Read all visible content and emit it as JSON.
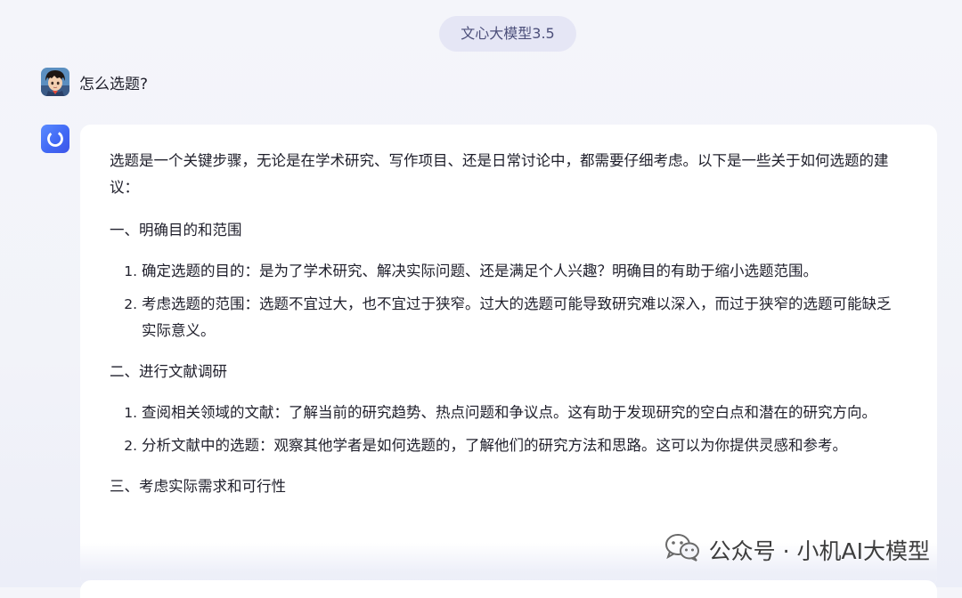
{
  "header": {
    "model_name": "文心大模型3.5"
  },
  "user_message": {
    "avatar_icon": "user-avatar",
    "text": "怎么选题?"
  },
  "assistant": {
    "icon": "ernie-bot-icon",
    "intro": "选题是一个关键步骤，无论是在学术研究、写作项目、还是日常讨论中，都需要仔细考虑。以下是一些关于如何选题的建议：",
    "sections": [
      {
        "heading": "一、明确目的和范围",
        "items": [
          "确定选题的目的：是为了学术研究、解决实际问题、还是满足个人兴趣？明确目的有助于缩小选题范围。",
          "考虑选题的范围：选题不宜过大，也不宜过于狭窄。过大的选题可能导致研究难以深入，而过于狭窄的选题可能缺乏实际意义。"
        ]
      },
      {
        "heading": "二、进行文献调研",
        "items": [
          "查阅相关领域的文献：了解当前的研究趋势、热点问题和争议点。这有助于发现研究的空白点和潜在的研究方向。",
          "分析文献中的选题：观察其他学者是如何选题的，了解他们的研究方法和思路。这可以为你提供灵感和参考。"
        ]
      },
      {
        "heading": "三、考虑实际需求和可行性",
        "items": []
      }
    ]
  },
  "watermark": {
    "text": "公众号 · 小机AI大模型",
    "icon": "wechat-icon"
  }
}
